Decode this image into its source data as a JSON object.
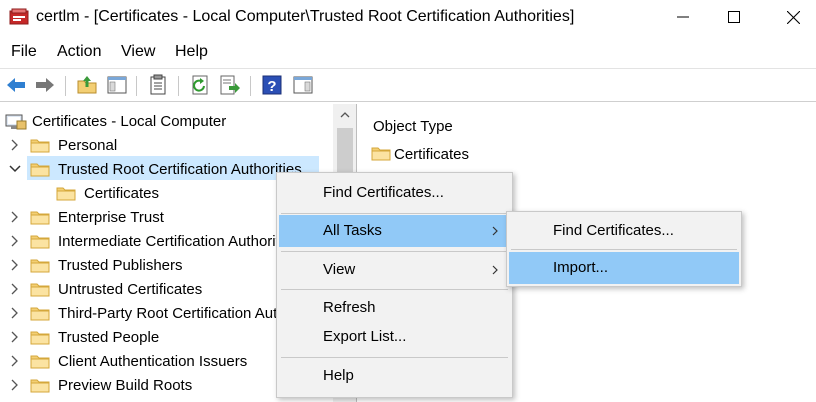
{
  "window": {
    "title": "certlm - [Certificates - Local Computer\\Trusted Root Certification Authorities]",
    "app_icon": "certificate-store-icon"
  },
  "menubar": {
    "items": [
      "File",
      "Action",
      "View",
      "Help"
    ]
  },
  "toolbar": {
    "buttons": [
      "back-icon",
      "forward-icon",
      "up-folder-icon",
      "show-hide-console-tree-icon",
      "properties-icon",
      "refresh-icon",
      "export-list-icon",
      "help-icon",
      "show-action-pane-icon"
    ]
  },
  "tree": {
    "root": "Certificates - Local Computer",
    "items": [
      {
        "label": "Personal",
        "expanded": false
      },
      {
        "label": "Trusted Root Certification Authorities",
        "expanded": true,
        "selected": true
      },
      {
        "label": "Certificates",
        "child": true
      },
      {
        "label": "Enterprise Trust",
        "expanded": false
      },
      {
        "label": "Intermediate Certification Authorities",
        "expanded": false
      },
      {
        "label": "Trusted Publishers",
        "expanded": false
      },
      {
        "label": "Untrusted Certificates",
        "expanded": false
      },
      {
        "label": "Third-Party Root Certification Authorities",
        "expanded": false
      },
      {
        "label": "Trusted People",
        "expanded": false
      },
      {
        "label": "Client Authentication Issuers",
        "expanded": false
      },
      {
        "label": "Preview Build Roots",
        "expanded": false
      }
    ]
  },
  "right_pane": {
    "column_header": "Object Type",
    "items": [
      "Certificates"
    ]
  },
  "context_menu": {
    "items": [
      "Find Certificates...",
      "All Tasks",
      "View",
      "Refresh",
      "Export List...",
      "Help"
    ],
    "highlighted": "All Tasks"
  },
  "submenu": {
    "items": [
      "Find Certificates...",
      "Import..."
    ],
    "highlighted": "Import..."
  },
  "colors": {
    "selection": "#cce8ff",
    "menu_highlight": "#91c9f7",
    "folder": "#f5d27a"
  }
}
